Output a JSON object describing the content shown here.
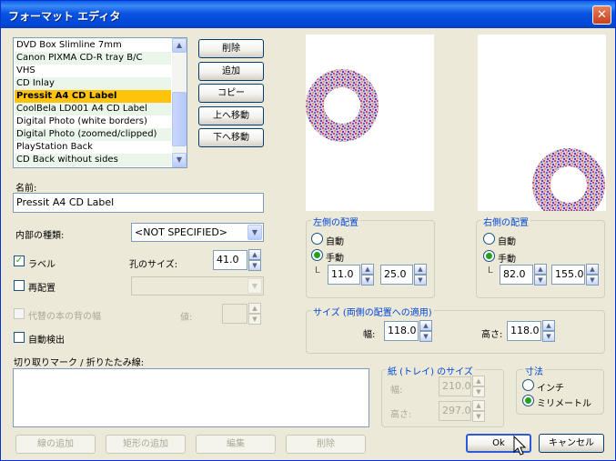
{
  "window": {
    "title": "フォーマット エディタ",
    "close_glyph": "✕"
  },
  "format_list": {
    "items": [
      "DVD Box Slimline 7mm",
      "Canon PIXMA CD-R tray B/C",
      "VHS",
      "CD Inlay",
      "Pressit A4 CD Label",
      "CoolBela LD001 A4 CD Label",
      "Digital Photo (white borders)",
      "Digital Photo (zoomed/clipped)",
      "PlayStation Back",
      "CD Back without sides"
    ],
    "selected_index": 4,
    "scroll_up_glyph": "▲",
    "scroll_down_glyph": "▼"
  },
  "list_buttons": {
    "delete": "削除",
    "add": "追加",
    "copy": "コピー",
    "move_up": "上へ移動",
    "move_down": "下へ移動"
  },
  "name": {
    "label": "名前:",
    "value": "Pressit A4 CD Label"
  },
  "internal_type": {
    "label": "内部の種類:",
    "value": "<NOT SPECIFIED>"
  },
  "label_check": {
    "label": "ラベル",
    "checked": true
  },
  "hole_size": {
    "label": "孔のサイズ:",
    "value": "41.0"
  },
  "rearrange_check": {
    "label": "再配置",
    "checked": false
  },
  "alt_spine": {
    "label": "代替の本の背の幅",
    "value_label": "値:",
    "value": ""
  },
  "auto_detect": {
    "label": "自動検出",
    "checked": false
  },
  "cut_marks": {
    "label": "切り取りマーク / 折りたたみ線:",
    "value": ""
  },
  "bottom_buttons": {
    "add_line": "線の追加",
    "add_rect": "矩形の追加",
    "edit": "編集",
    "delete": "削除"
  },
  "left_placement": {
    "title": "左側の配置",
    "auto": "自動",
    "manual": "手動",
    "selected": "manual",
    "x": "11.0",
    "y": "25.0",
    "corner_glyph": "L"
  },
  "right_placement": {
    "title": "右側の配置",
    "auto": "自動",
    "manual": "手動",
    "selected": "manual",
    "x": "82.0",
    "y": "155.0",
    "corner_glyph": "L"
  },
  "size_group": {
    "title": "サイズ (両側の配置への適用)",
    "width_label": "幅:",
    "width": "118.0",
    "height_label": "高さ:",
    "height": "118.0"
  },
  "paper_group": {
    "title": "紙 (トレイ) のサイズ",
    "width_label": "幅:",
    "width": "210.0",
    "height_label": "高さ:",
    "height": "297.0"
  },
  "units_group": {
    "title": "寸法",
    "inch": "インチ",
    "mm": "ミリメートル",
    "selected": "mm"
  },
  "dialog_buttons": {
    "ok": "Ok",
    "cancel": "キャンセル"
  },
  "spin_glyphs": {
    "up": "▲",
    "down": "▼"
  },
  "combo_glyph": "▼",
  "check_glyph": "✓",
  "colors": {
    "title_bar": "#0A54E2",
    "selected_row": "#FFC30B",
    "group_title": "#0046D5",
    "dialog_bg": "#ECE9D8"
  }
}
